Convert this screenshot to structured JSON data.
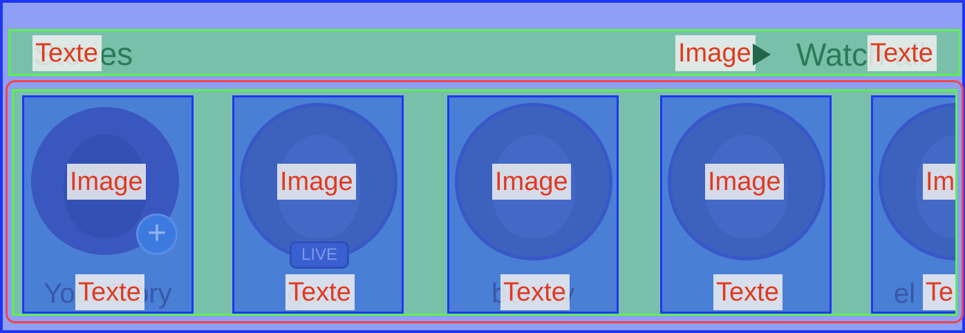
{
  "header": {
    "title": "Stories",
    "title_annotation": "Texte",
    "watch_icon_annotation": "Image",
    "watch_label": "Watch all",
    "watch_annotation": "Texte"
  },
  "stories": [
    {
      "name": "Your Story",
      "image_annotation": "Image",
      "name_annotation": "Texte",
      "add_icon": "plus-icon"
    },
    {
      "name": "gr...a",
      "image_annotation": "Image",
      "name_annotation": "Texte",
      "badge": "LIVE"
    },
    {
      "name": "be...uy",
      "image_annotation": "Image",
      "name_annotation": "Texte"
    },
    {
      "name": "",
      "image_annotation": "Image",
      "name_annotation": "Texte"
    },
    {
      "name": "el",
      "image_annotation": "Im",
      "name_annotation": "Te"
    }
  ],
  "colors": {
    "accent": "#1e36f2",
    "header_bg": "#79c0ab",
    "story_bg": "#4a7fd6",
    "annotation_text": "#e03a1e"
  }
}
